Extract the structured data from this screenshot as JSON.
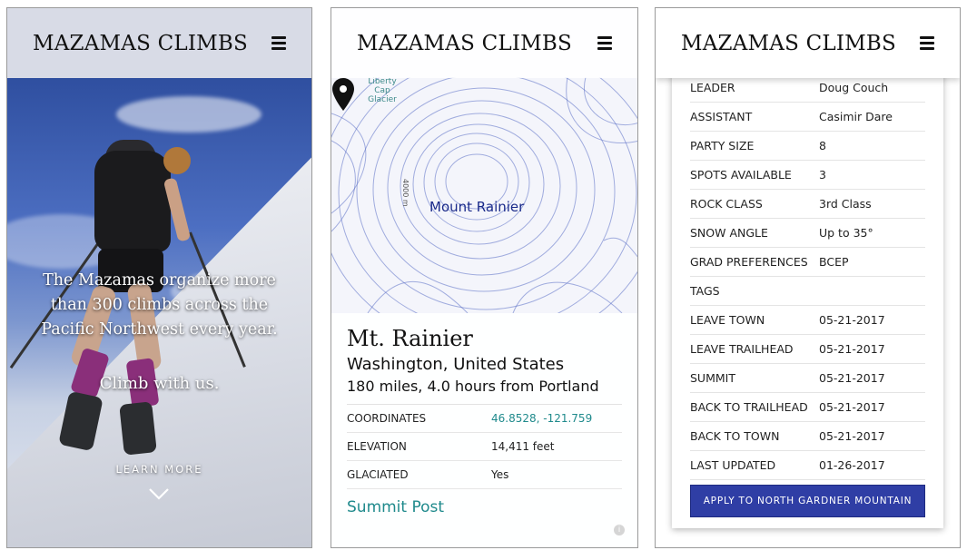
{
  "brand": "MAZAMAS CLIMBS",
  "hero": {
    "headline": "The Mazamas organize more than 300 climbs across the Pacific Northwest every year.",
    "tagline": "Climb with us.",
    "learn_more": "LEARN MORE"
  },
  "map": {
    "peak_label": "Mount Rainier",
    "glacier_label": "Liberty Cap Glacier",
    "elevation_label": "4000 m"
  },
  "mountain": {
    "name": "Mt. Rainier",
    "location": "Washington, United States",
    "distance": "180 miles, 4.0 hours from Portland",
    "facts": [
      {
        "key": "COORDINATES",
        "value": "46.8528, -121.759",
        "link": true
      },
      {
        "key": "ELEVATION",
        "value": "14,411 feet",
        "link": false
      },
      {
        "key": "GLACIATED",
        "value": "Yes",
        "link": false
      }
    ],
    "summit_post": "Summit Post"
  },
  "climb": {
    "rows": [
      {
        "key": "LEADER",
        "value": "Doug Couch"
      },
      {
        "key": "ASSISTANT",
        "value": "Casimir Dare"
      },
      {
        "key": "PARTY SIZE",
        "value": "8"
      },
      {
        "key": "SPOTS AVAILABLE",
        "value": "3"
      },
      {
        "key": "ROCK CLASS",
        "value": "3rd Class"
      },
      {
        "key": "SNOW ANGLE",
        "value": "Up to 35°"
      },
      {
        "key": "GRAD PREFERENCES",
        "value": "BCEP"
      },
      {
        "key": "TAGS",
        "value": ""
      },
      {
        "key": "LEAVE TOWN",
        "value": "05-21-2017"
      },
      {
        "key": "LEAVE TRAILHEAD",
        "value": "05-21-2017"
      },
      {
        "key": "SUMMIT",
        "value": "05-21-2017"
      },
      {
        "key": "BACK TO TRAILHEAD",
        "value": "05-21-2017"
      },
      {
        "key": "BACK TO TOWN",
        "value": "05-21-2017"
      },
      {
        "key": "LAST UPDATED",
        "value": "01-26-2017"
      }
    ],
    "apply_label": "APPLY TO NORTH GARDNER MOUNTAIN"
  },
  "colors": {
    "accent": "#2f3ea5",
    "link": "#1f8a8c",
    "header_bg": "#d8dbe6"
  }
}
